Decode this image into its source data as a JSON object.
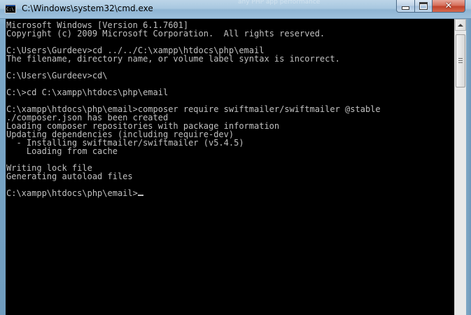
{
  "window": {
    "title": "C:\\Windows\\system32\\cmd.exe",
    "background_title_fragment": "any PHP app performance",
    "icon_text": "C:\\"
  },
  "controls": {
    "close_glyph": "✕"
  },
  "console": {
    "lines": [
      "Microsoft Windows [Version 6.1.7601]",
      "Copyright (c) 2009 Microsoft Corporation.  All rights reserved.",
      "",
      "C:\\Users\\Gurdeev>cd ../../C:\\xampp\\htdocs\\php\\email",
      "The filename, directory name, or volume label syntax is incorrect.",
      "",
      "C:\\Users\\Gurdeev>cd\\",
      "",
      "C:\\>cd C:\\xampp\\htdocs\\php\\email",
      "",
      "C:\\xampp\\htdocs\\php\\email>composer require swiftmailer/swiftmailer @stable",
      "./composer.json has been created",
      "Loading composer repositories with package information",
      "Updating dependencies (including require-dev)",
      "  - Installing swiftmailer/swiftmailer (v5.4.5)",
      "    Loading from cache",
      "",
      "Writing lock file",
      "Generating autoload files",
      "",
      "C:\\xampp\\htdocs\\php\\email>"
    ]
  },
  "colors": {
    "console_bg": "#000000",
    "console_fg": "#c0c0c0",
    "close_button": "#c1432b"
  }
}
